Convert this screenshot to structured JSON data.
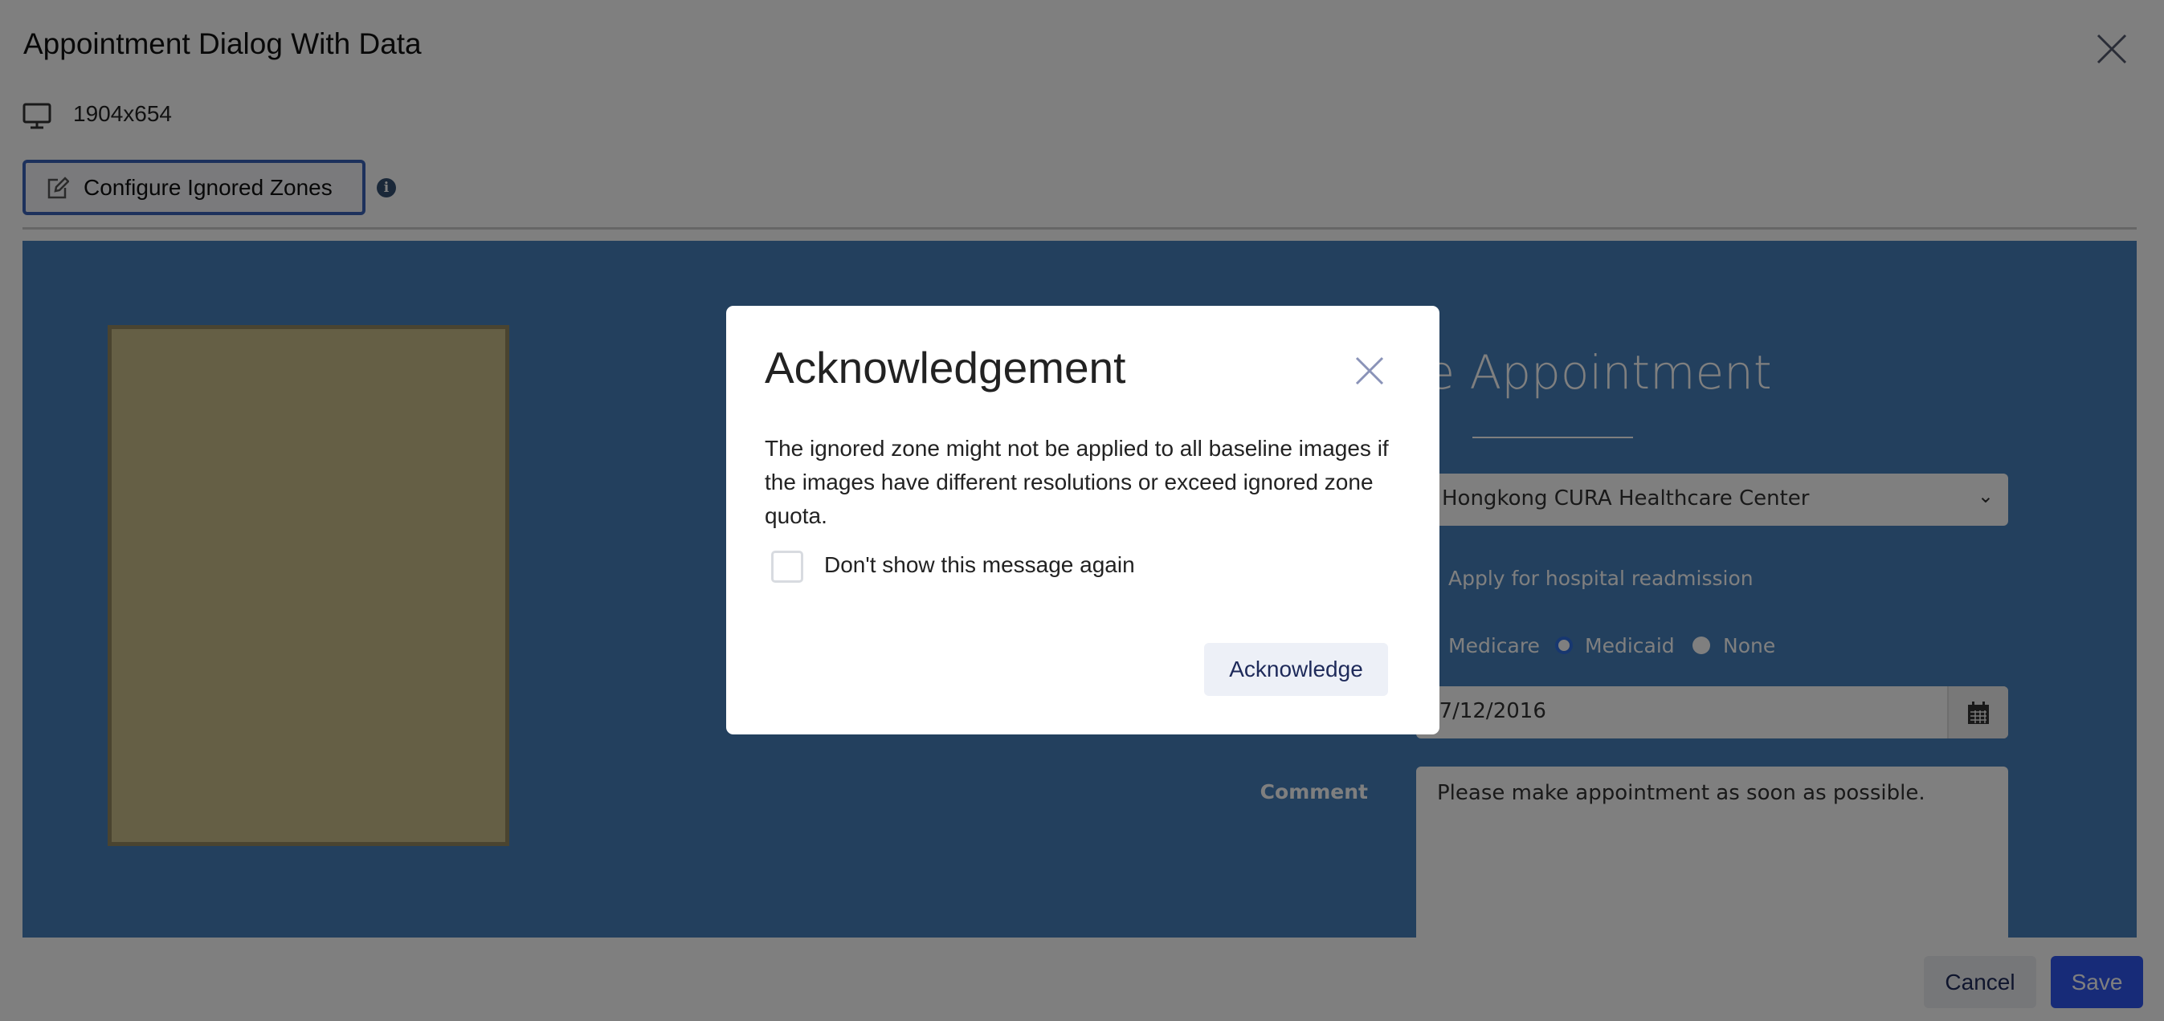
{
  "header": {
    "title": "Appointment Dialog With Data",
    "resolution": "1904x654",
    "configure_label": "Configure Ignored Zones"
  },
  "screenshot": {
    "heading": "Make Appointment",
    "facility": "Hongkong CURA Healthcare Center",
    "readmission_label": "Apply for hospital readmission",
    "programs": [
      "Medicare",
      "Medicaid",
      "None"
    ],
    "selected_program": "Medicaid",
    "visit_date": "27/12/2016",
    "comment_label": "Comment",
    "comment": "Please make appointment as soon as possible."
  },
  "footer": {
    "cancel_label": "Cancel",
    "save_label": "Save"
  },
  "modal": {
    "title": "Acknowledgement",
    "body": "The ignored zone might not be applied to all baseline images if the images have different resolutions or exceed ignored zone quota.",
    "checkbox_label": "Don't show this message again",
    "button_label": "Acknowledge"
  }
}
